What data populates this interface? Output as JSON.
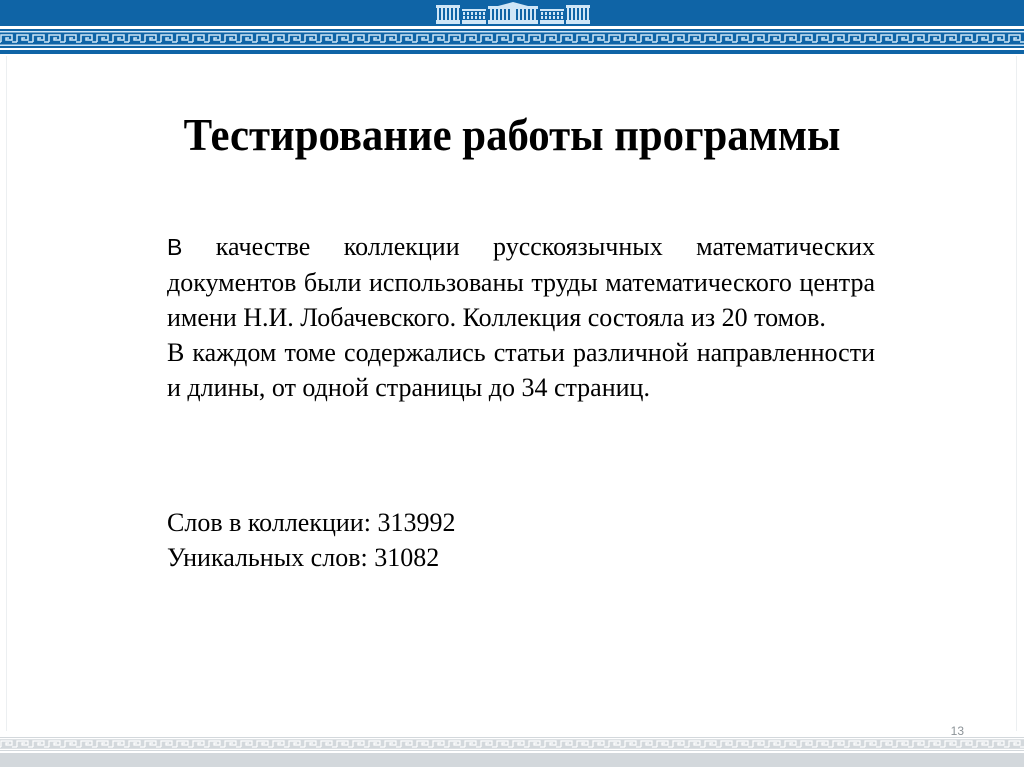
{
  "slide": {
    "title": "Тестирование работы программы",
    "paragraphs": [
      {
        "lead": "В",
        "text": " качестве коллекции русскоязычных математических документов были использованы труды математического центра имени Н.И. Лобачевского. Коллекция состояла из 20 томов."
      },
      {
        "lead": "В",
        "text": " каждом томе содержались статьи различной направленности и длины, от одной страницы до 34 страниц."
      }
    ],
    "stats": [
      {
        "label": "Слов в коллекции:",
        "value": "313992"
      },
      {
        "label": "Уникальных слов:",
        "value": "31082"
      }
    ],
    "page_number": "13"
  },
  "theme": {
    "header_color": "#0f64a6",
    "header_pattern_light": "#cfe6f7",
    "footer_color": "#d3d8dc",
    "footer_pattern_light": "#ffffff",
    "logo_color": "#cfe6f7",
    "text_color": "#000000"
  },
  "icons": {
    "logo": "building-colonnade-icon",
    "header_ornament": "greek-key-meander",
    "footer_ornament": "greek-key-meander"
  }
}
